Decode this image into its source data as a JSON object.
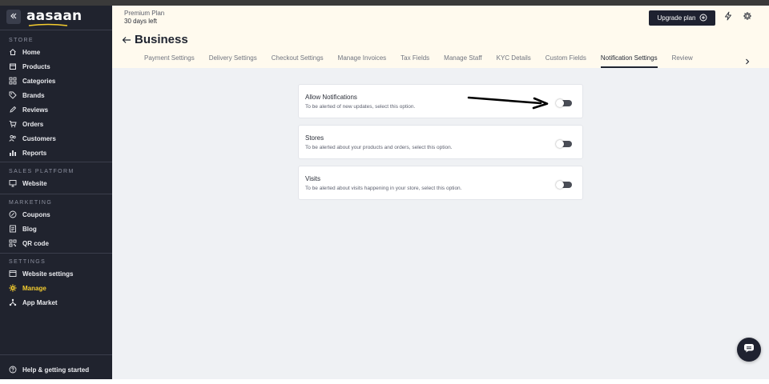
{
  "app": {
    "logo": "aasaan",
    "brand_accent": "#f5cd2e"
  },
  "sidebar": {
    "collapse_icon": "double-chevron-left-icon",
    "sections": [
      {
        "title": "STORE",
        "items": [
          {
            "label": "Home",
            "icon": "home-icon"
          },
          {
            "label": "Products",
            "icon": "box-icon"
          },
          {
            "label": "Categories",
            "icon": "grid-icon"
          },
          {
            "label": "Brands",
            "icon": "tag-icon"
          },
          {
            "label": "Reviews",
            "icon": "pen-icon"
          },
          {
            "label": "Orders",
            "icon": "cart-icon"
          },
          {
            "label": "Customers",
            "icon": "users-icon"
          },
          {
            "label": "Reports",
            "icon": "bar-chart-icon"
          }
        ]
      },
      {
        "title": "SALES PLATFORM",
        "items": [
          {
            "label": "Website",
            "icon": "monitor-icon"
          }
        ]
      },
      {
        "title": "MARKETING",
        "items": [
          {
            "label": "Coupons",
            "icon": "percent-icon"
          },
          {
            "label": "Blog",
            "icon": "document-icon"
          },
          {
            "label": "QR code",
            "icon": "qr-code-icon"
          }
        ]
      },
      {
        "title": "SETTINGS",
        "items": [
          {
            "label": "Website settings",
            "icon": "window-settings-icon"
          },
          {
            "label": "Manage",
            "icon": "gear-icon",
            "active": true
          },
          {
            "label": "App Market",
            "icon": "share-nodes-icon"
          }
        ]
      }
    ],
    "help": {
      "label": "Help & getting started",
      "icon": "help-circle-icon"
    }
  },
  "header": {
    "plan_name": "Premium Plan",
    "days_left": "30 days left",
    "upgrade_label": "Upgrade plan",
    "page_title": "Business",
    "tabs": [
      "Payment Settings",
      "Delivery Settings",
      "Checkout Settings",
      "Manage Invoices",
      "Tax Fields",
      "Manage Staff",
      "KYC Details",
      "Custom Fields",
      "Notification Settings",
      "Review"
    ],
    "active_tab": "Notification Settings"
  },
  "notifications": [
    {
      "title": "Allow Notifications",
      "description": "To be alerted of new updates, select this option.",
      "enabled": false
    },
    {
      "title": "Stores",
      "description": "To be alerted about your products and orders, select this option.",
      "enabled": false
    },
    {
      "title": "Visits",
      "description": "To be alerted about visits happening in your store, select this option.",
      "enabled": false
    }
  ]
}
